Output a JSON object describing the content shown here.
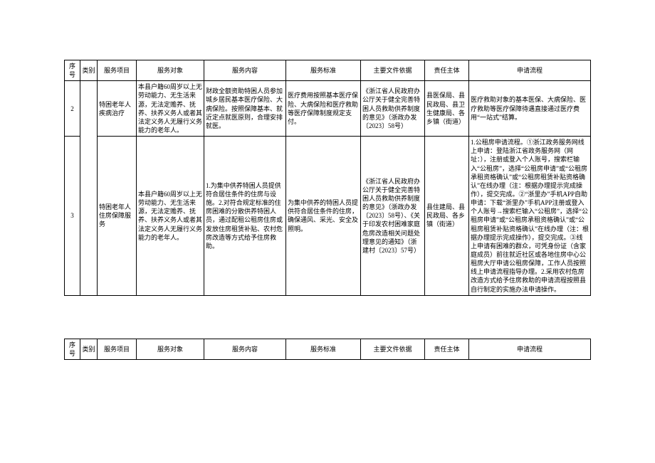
{
  "headers": {
    "num": "序号",
    "cat": "类别",
    "proj": "服务项目",
    "obj": "服务对象",
    "cont": "服务内容",
    "std": "服务标准",
    "doc": "主要文件依据",
    "resp": "责任主体",
    "flow": "申请流程"
  },
  "rows": [
    {
      "num": "2",
      "cat": "",
      "proj": "特困老年人疾病治疗",
      "obj": "本县户籍60周岁以上无劳动能力、无生活来源，无法定赡养、抚养、扶养义务人或者其法定义务人无履行义务能力的老年人。",
      "cont": "财政全额资助特困人员参加城乡居民基本医疗保险、大病保险。按照保障基本、就近定点就医原则，合理安排就医。",
      "std": "医疗费用按照基本医疗保险、大病保险和医疗救助等医疗保障制度规定支付。",
      "doc": "《浙江省人民政府办公厅关于健全完善特困人员救助供养制度的意见》（浙政办发〔2023〕58号）",
      "resp": "县医保局、县民政局、县卫生健康局、各乡镇（街道）",
      "flow": "医疗救助对象的基本医保、大病保险、医疗救助等医疗保障待遇直接通过医疗费用“一站式”结算。"
    },
    {
      "num": "3",
      "cat": "",
      "proj": "特困老年人住房保障服务",
      "obj": "本县户籍60周岁以上无劳动能力、无生活来源，无法定赡养、抚养、扶养义务人或者其法定义务人无履行义务能力的老年人。",
      "cont": "1.为集中供养特困人员提供符合居住条件的住房与设施。2.对符合规定标准的住房困难的分散供养特困人员，通过配租公租房住房或发放住房租赁补贴、农村危房改造等方式给予住房救助。",
      "std": "为集中供养的特困人员提供符合居住条件的住房，确保通风、采光、安全及照明。",
      "doc": "《浙江省人民政府办公厅关于健全完善特困人员救助供养制度的意见》（浙政办发〔2023〕58号）、《关于印发农村困难家庭危房改造相关问题处理意见的通知》（浙建村〔2023〕57号）",
      "resp": "县住建局、县民政局、各乡镇（街道）",
      "flow": "1.公租房申请流程。①浙江政务服务网线上申请：登陆浙江省政务服务网（网址：），注册或登入个人账号，搜索栏输入“公租房”，选择“公租房申请”或“公租房承租资格确认”或“公租房租赁补贴资格确认”在线办理（注：根据办理提示完成操作），提交完成。②“浙里办”手机APP自助申请：下载“浙里办”手机APP注册或登入个人账号→搜索栏输入“公租房”，选择“公租房申请”或“公租房承租资格确认”或“公租房租赁补贴资格确认”在线办理（注：根据办理提示完成操作），提交完成。③线上申请有困难的群众，可凭身份证（含家庭成员）前往就近社区或各地住房中心公租房大厅申请公租房保障，工作人员按照线上申请流程指导办理。2.采用农村危房改造方式给予住房救助的申请流程按照县自行制定的实施办法申请操作。"
    }
  ]
}
